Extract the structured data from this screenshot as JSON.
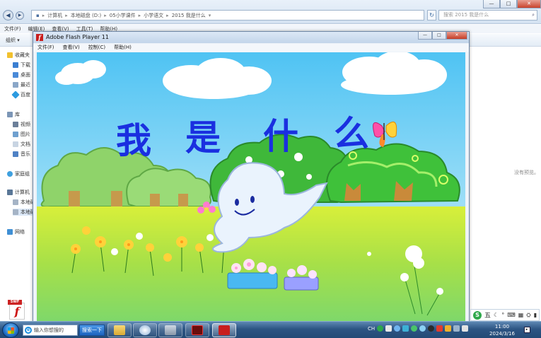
{
  "explorer": {
    "address_crumbs": [
      "计算机",
      "本地磁盘 (D:)",
      "05小学课件",
      "小学语文",
      "2015  我是什么"
    ],
    "search_placeholder": "搜索 2015  我是什么",
    "menu": [
      "文件(F)",
      "编辑(E)",
      "查看(V)",
      "工具(T)",
      "帮助(H)"
    ],
    "organize": "组织 ▾",
    "sidebar": [
      "收藏夹",
      "下载",
      "桌面",
      "最近",
      "百度",
      "库",
      "视频",
      "图片",
      "文档",
      "音乐",
      "家庭组",
      "计算机",
      "本地磁",
      "本地磁",
      "网络"
    ],
    "preview_text": "没有预览。",
    "window_controls": [
      "—",
      "□",
      "✕"
    ]
  },
  "flash": {
    "title": "Adobe Flash Player 11",
    "menu": [
      "文件(F)",
      "查看(V)",
      "控制(C)",
      "帮助(H)"
    ],
    "controls": [
      "—",
      "□",
      "✕"
    ],
    "stage_title": [
      "我",
      "是",
      "什",
      "么"
    ]
  },
  "taskbar": {
    "search_placeholder": "输入你想搜的",
    "search_button": "搜索一下",
    "clock_time": "11:00",
    "clock_date": "2024/3/16",
    "ime_label": "五"
  },
  "colors": {
    "sky_top": "#5cc9f5",
    "grass": "#a6e04a",
    "title_blue": "#1a2fe0",
    "taskbar": "#2d5583",
    "flash_red": "#c81e1e"
  }
}
